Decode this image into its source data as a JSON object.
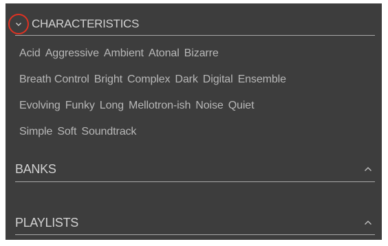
{
  "characteristics": {
    "title": "CHARACTERISTICS",
    "toggle_icon": "chevron-down-icon",
    "rows": [
      [
        "Acid",
        "Aggressive",
        "Ambient",
        "Atonal",
        "Bizarre"
      ],
      [
        "Breath Control",
        "Bright",
        "Complex",
        "Dark",
        "Digital",
        "Ensemble"
      ],
      [
        "Evolving",
        "Funky",
        "Long",
        "Mellotron-ish",
        "Noise",
        "Quiet"
      ],
      [
        "Simple",
        "Soft",
        "Soundtrack"
      ]
    ]
  },
  "banks": {
    "title": "BANKS",
    "toggle_icon": "chevron-up-icon"
  },
  "playlists": {
    "title": "PLAYLISTS",
    "toggle_icon": "chevron-up-icon"
  },
  "colors": {
    "panel_background": "#3d3d3d",
    "header_text": "#d2d2d2",
    "tag_text": "#b8b8b8",
    "divider": "#a9a9a9",
    "highlight_circle": "#e03222"
  }
}
